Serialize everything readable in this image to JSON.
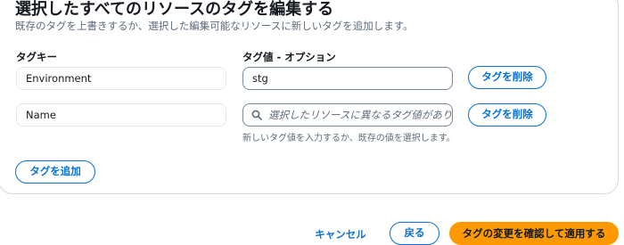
{
  "panel": {
    "title": "選択したすべてのリソースのタグを編集する",
    "subtitle": "既存のタグを上書きするか、選択した編集可能なリソースに新しいタグを追加します。",
    "key_label": "タグキー",
    "value_label": "タグ値 - オプション",
    "tags": [
      {
        "key": "Environment",
        "value": "stg",
        "value_placeholder": "",
        "remove_label": "タグを削除"
      },
      {
        "key": "Name",
        "value": "",
        "value_placeholder": "選択したリソースに異なるタグ値があります",
        "remove_label": "タグを削除",
        "hint": "新しいタグ値を入力するか、既存の値を選択します。"
      }
    ],
    "add_tag_label": "タグを追加"
  },
  "footer": {
    "cancel_label": "キャンセル",
    "back_label": "戻る",
    "confirm_label": "タグの変更を確認して適用する"
  },
  "colors": {
    "accent": "#0972d3",
    "primary_button": "#ff9900",
    "text": "#16191f",
    "muted_text": "#5f6b7a"
  },
  "icons": {
    "search": "search-icon"
  }
}
